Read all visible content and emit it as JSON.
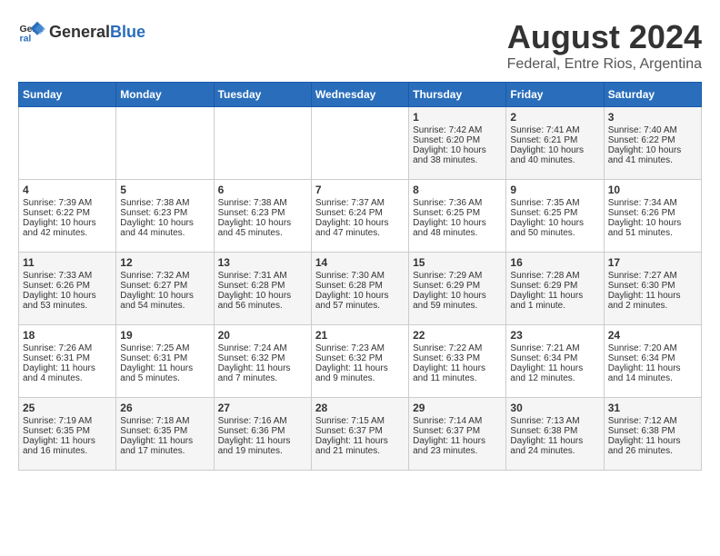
{
  "header": {
    "logo_general": "General",
    "logo_blue": "Blue",
    "title": "August 2024",
    "subtitle": "Federal, Entre Rios, Argentina"
  },
  "calendar": {
    "days_of_week": [
      "Sunday",
      "Monday",
      "Tuesday",
      "Wednesday",
      "Thursday",
      "Friday",
      "Saturday"
    ],
    "weeks": [
      [
        {
          "day": "",
          "content": ""
        },
        {
          "day": "",
          "content": ""
        },
        {
          "day": "",
          "content": ""
        },
        {
          "day": "",
          "content": ""
        },
        {
          "day": "1",
          "content": "Sunrise: 7:42 AM\nSunset: 6:20 PM\nDaylight: 10 hours\nand 38 minutes."
        },
        {
          "day": "2",
          "content": "Sunrise: 7:41 AM\nSunset: 6:21 PM\nDaylight: 10 hours\nand 40 minutes."
        },
        {
          "day": "3",
          "content": "Sunrise: 7:40 AM\nSunset: 6:22 PM\nDaylight: 10 hours\nand 41 minutes."
        }
      ],
      [
        {
          "day": "4",
          "content": "Sunrise: 7:39 AM\nSunset: 6:22 PM\nDaylight: 10 hours\nand 42 minutes."
        },
        {
          "day": "5",
          "content": "Sunrise: 7:38 AM\nSunset: 6:23 PM\nDaylight: 10 hours\nand 44 minutes."
        },
        {
          "day": "6",
          "content": "Sunrise: 7:38 AM\nSunset: 6:23 PM\nDaylight: 10 hours\nand 45 minutes."
        },
        {
          "day": "7",
          "content": "Sunrise: 7:37 AM\nSunset: 6:24 PM\nDaylight: 10 hours\nand 47 minutes."
        },
        {
          "day": "8",
          "content": "Sunrise: 7:36 AM\nSunset: 6:25 PM\nDaylight: 10 hours\nand 48 minutes."
        },
        {
          "day": "9",
          "content": "Sunrise: 7:35 AM\nSunset: 6:25 PM\nDaylight: 10 hours\nand 50 minutes."
        },
        {
          "day": "10",
          "content": "Sunrise: 7:34 AM\nSunset: 6:26 PM\nDaylight: 10 hours\nand 51 minutes."
        }
      ],
      [
        {
          "day": "11",
          "content": "Sunrise: 7:33 AM\nSunset: 6:26 PM\nDaylight: 10 hours\nand 53 minutes."
        },
        {
          "day": "12",
          "content": "Sunrise: 7:32 AM\nSunset: 6:27 PM\nDaylight: 10 hours\nand 54 minutes."
        },
        {
          "day": "13",
          "content": "Sunrise: 7:31 AM\nSunset: 6:28 PM\nDaylight: 10 hours\nand 56 minutes."
        },
        {
          "day": "14",
          "content": "Sunrise: 7:30 AM\nSunset: 6:28 PM\nDaylight: 10 hours\nand 57 minutes."
        },
        {
          "day": "15",
          "content": "Sunrise: 7:29 AM\nSunset: 6:29 PM\nDaylight: 10 hours\nand 59 minutes."
        },
        {
          "day": "16",
          "content": "Sunrise: 7:28 AM\nSunset: 6:29 PM\nDaylight: 11 hours\nand 1 minute."
        },
        {
          "day": "17",
          "content": "Sunrise: 7:27 AM\nSunset: 6:30 PM\nDaylight: 11 hours\nand 2 minutes."
        }
      ],
      [
        {
          "day": "18",
          "content": "Sunrise: 7:26 AM\nSunset: 6:31 PM\nDaylight: 11 hours\nand 4 minutes."
        },
        {
          "day": "19",
          "content": "Sunrise: 7:25 AM\nSunset: 6:31 PM\nDaylight: 11 hours\nand 5 minutes."
        },
        {
          "day": "20",
          "content": "Sunrise: 7:24 AM\nSunset: 6:32 PM\nDaylight: 11 hours\nand 7 minutes."
        },
        {
          "day": "21",
          "content": "Sunrise: 7:23 AM\nSunset: 6:32 PM\nDaylight: 11 hours\nand 9 minutes."
        },
        {
          "day": "22",
          "content": "Sunrise: 7:22 AM\nSunset: 6:33 PM\nDaylight: 11 hours\nand 11 minutes."
        },
        {
          "day": "23",
          "content": "Sunrise: 7:21 AM\nSunset: 6:34 PM\nDaylight: 11 hours\nand 12 minutes."
        },
        {
          "day": "24",
          "content": "Sunrise: 7:20 AM\nSunset: 6:34 PM\nDaylight: 11 hours\nand 14 minutes."
        }
      ],
      [
        {
          "day": "25",
          "content": "Sunrise: 7:19 AM\nSunset: 6:35 PM\nDaylight: 11 hours\nand 16 minutes."
        },
        {
          "day": "26",
          "content": "Sunrise: 7:18 AM\nSunset: 6:35 PM\nDaylight: 11 hours\nand 17 minutes."
        },
        {
          "day": "27",
          "content": "Sunrise: 7:16 AM\nSunset: 6:36 PM\nDaylight: 11 hours\nand 19 minutes."
        },
        {
          "day": "28",
          "content": "Sunrise: 7:15 AM\nSunset: 6:37 PM\nDaylight: 11 hours\nand 21 minutes."
        },
        {
          "day": "29",
          "content": "Sunrise: 7:14 AM\nSunset: 6:37 PM\nDaylight: 11 hours\nand 23 minutes."
        },
        {
          "day": "30",
          "content": "Sunrise: 7:13 AM\nSunset: 6:38 PM\nDaylight: 11 hours\nand 24 minutes."
        },
        {
          "day": "31",
          "content": "Sunrise: 7:12 AM\nSunset: 6:38 PM\nDaylight: 11 hours\nand 26 minutes."
        }
      ]
    ]
  }
}
